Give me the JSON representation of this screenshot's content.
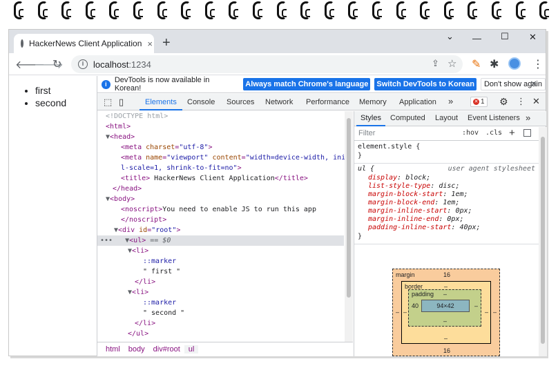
{
  "browser": {
    "tab_title": "HackerNews Client Application",
    "tab_close": "×",
    "new_tab": "+",
    "window_controls": {
      "minimize": "—",
      "maximize": "☐",
      "close": "✕",
      "dropdown": "⌄"
    },
    "url_host": "localhost",
    "url_port": ":1234"
  },
  "page": {
    "list_items": [
      "first",
      "second"
    ]
  },
  "devtools": {
    "infobar": {
      "message": "DevTools is now available in Korean!",
      "btn_match": "Always match Chrome's language",
      "btn_switch": "Switch DevTools to Korean",
      "btn_dismiss": "Don't show again"
    },
    "tabs": [
      "Elements",
      "Console",
      "Sources",
      "Network",
      "Performance",
      "Memory",
      "Application"
    ],
    "more_tabs": "»",
    "error_count": "1",
    "dom": {
      "doctype": "<!DOCTYPE html>",
      "meta_charset_val": "\"utf-8\"",
      "meta_viewport_val": "\"width=device-width, initia",
      "meta_viewport_cont": "l-scale=1, shrink-to-fit=no\"",
      "title_text": " HackerNews Client Application",
      "noscript_text": "You need to enable JS to run this app",
      "root_id_val": "\"root\"",
      "selected_suffix": "== $0",
      "marker": "::marker",
      "text_first": "\" first \"",
      "text_second": "\" second \"",
      "ellipsis": "•••"
    },
    "breadcrumbs": [
      "html",
      "body",
      "div#root",
      "ul"
    ],
    "styles": {
      "tabs": [
        "Styles",
        "Computed",
        "Layout",
        "Event Listeners"
      ],
      "more": "»",
      "filter_placeholder": "Filter",
      "hov": ":hov",
      "cls": ".cls",
      "plus": "+",
      "element_style": "element.style {",
      "close_brace": "}",
      "rule_selector": "ul {",
      "user_agent": "user agent stylesheet",
      "declarations": [
        {
          "prop": "display",
          "value": "block;"
        },
        {
          "prop": "list-style-type",
          "value": "disc;"
        },
        {
          "prop": "margin-block-start",
          "value": "1em;"
        },
        {
          "prop": "margin-block-end",
          "value": "1em;"
        },
        {
          "prop": "margin-inline-start",
          "value": "0px;"
        },
        {
          "prop": "margin-inline-end",
          "value": "0px;"
        },
        {
          "prop": "padding-inline-start",
          "value": "40px;"
        }
      ],
      "box_model": {
        "margin_label": "margin",
        "margin_top": "16",
        "margin_bottom": "16",
        "margin_left": "–",
        "margin_right": "–",
        "border_label": "border",
        "border_top": "–",
        "border_bottom": "–",
        "border_left": "–",
        "border_right": "–",
        "padding_label": "padding",
        "padding_top": "–",
        "padding_bottom": "–",
        "padding_left": "40",
        "padding_right": "–",
        "content": "94×42"
      }
    }
  }
}
